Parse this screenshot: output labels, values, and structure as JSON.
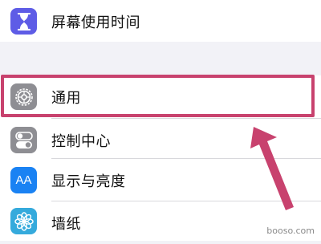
{
  "settings": {
    "rows": [
      {
        "label": "屏幕使用时间",
        "icon": "hourglass-icon",
        "color": "#5e5ce6"
      },
      {
        "label": "通用",
        "icon": "gear-icon",
        "color": "#8e8e93"
      },
      {
        "label": "控制中心",
        "icon": "toggle-switches-icon",
        "color": "#8e8e93"
      },
      {
        "label": "显示与亮度",
        "icon": "text-size-icon",
        "color": "#1a82f3",
        "icon_text": "AA"
      },
      {
        "label": "墙纸",
        "icon": "flower-icon",
        "color": "#35aadc"
      }
    ]
  },
  "annotation": {
    "highlight_color": "#c8426e",
    "arrow_color": "#c8426e",
    "highlighted_row": "通用"
  },
  "watermark": "booso.com"
}
